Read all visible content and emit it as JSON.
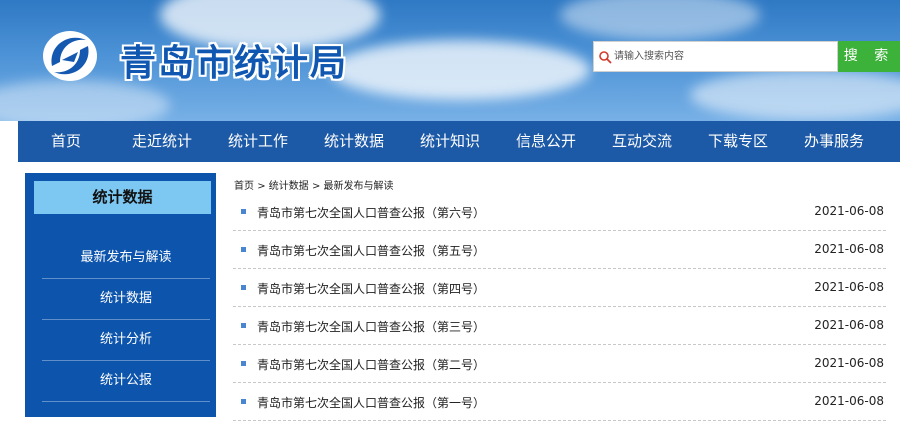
{
  "site": {
    "title": "青岛市统计局"
  },
  "search": {
    "placeholder": "请输入搜索内容",
    "button_label": "搜 索"
  },
  "nav": {
    "items": [
      {
        "label": "首页"
      },
      {
        "label": "走近统计"
      },
      {
        "label": "统计工作"
      },
      {
        "label": "统计数据"
      },
      {
        "label": "统计知识"
      },
      {
        "label": "信息公开"
      },
      {
        "label": "互动交流"
      },
      {
        "label": "下载专区"
      },
      {
        "label": "办事服务"
      }
    ]
  },
  "sidebar": {
    "title": "统计数据",
    "items": [
      {
        "label": "最新发布与解读"
      },
      {
        "label": "统计数据"
      },
      {
        "label": "统计分析"
      },
      {
        "label": "统计公报"
      }
    ]
  },
  "breadcrumb": {
    "home": "首页",
    "level1": "统计数据",
    "level2": "最新发布与解读",
    "separator": ">"
  },
  "articles": [
    {
      "title": "青岛市第七次全国人口普查公报（第六号）",
      "date": "2021-06-08"
    },
    {
      "title": "青岛市第七次全国人口普查公报（第五号）",
      "date": "2021-06-08"
    },
    {
      "title": "青岛市第七次全国人口普查公报（第四号）",
      "date": "2021-06-08"
    },
    {
      "title": "青岛市第七次全国人口普查公报（第三号）",
      "date": "2021-06-08"
    },
    {
      "title": "青岛市第七次全国人口普查公报（第二号）",
      "date": "2021-06-08"
    },
    {
      "title": "青岛市第七次全国人口普查公报（第一号）",
      "date": "2021-06-08"
    }
  ],
  "colors": {
    "nav_bg": "#1c59a6",
    "sidebar_bg": "#0d54ad",
    "sidebar_title_bg": "#7cc8f2",
    "search_button": "#3db23a"
  },
  "icons": {
    "logo": "qingdao-stats-logo",
    "search": "search-icon"
  }
}
